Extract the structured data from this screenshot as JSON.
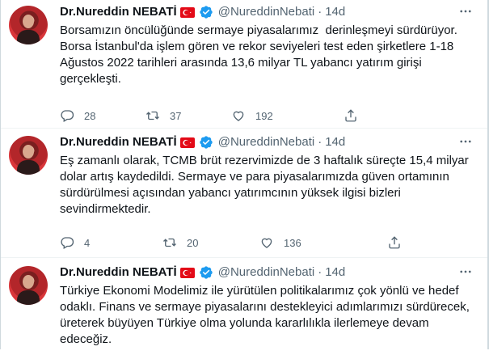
{
  "tweets": [
    {
      "name": "Dr.Nureddin NEBATİ",
      "handle": "@NureddinNebati",
      "separator": "·",
      "time": "14d",
      "text": "Borsamızın öncülüğünde sermaye piyasalarımız  derinleşmeyi sürdürüyor.\nBorsa İstanbul'da işlem gören ve rekor seviyeleri test eden şirketlere 1-18\nAğustos 2022 tarihleri arasında 13,6 milyar TL yabancı yatırım girişi\ngerçekleşti.",
      "replies": "28",
      "retweets": "37",
      "likes": "192"
    },
    {
      "name": "Dr.Nureddin NEBATİ",
      "handle": "@NureddinNebati",
      "separator": "·",
      "time": "14d",
      "text": "Eş zamanlı olarak, TCMB brüt rezervimizde de 3 haftalık süreçte 15,4 milyar\ndolar artış kaydedildi. Sermaye ve para piyasalarımızda güven ortamının\nsürdürülmesi açısından yabancı yatırımcının yüksek ilgisi bizleri\nsevindirmektedir.",
      "replies": "4",
      "retweets": "20",
      "likes": "136"
    },
    {
      "name": "Dr.Nureddin NEBATİ",
      "handle": "@NureddinNebati",
      "separator": "·",
      "time": "14d",
      "text": "Türkiye Ekonomi Modelimiz ile yürütülen politikalarımız çok yönlü ve hedef\nodaklı. Finans ve sermaye piyasalarını destekleyici adımlarımızı sürdürecek,\nüreterek büyüyen Türkiye olma yolunda kararlılıkla ilerlemeye devam\nedeceğiz."
    }
  ],
  "colors": {
    "text": "#0f1419",
    "secondary": "#536471",
    "verified": "#1d9bf0",
    "flag": "#e30a17"
  },
  "icons": [
    "avatar",
    "turkey-flag-icon",
    "verified-badge-icon",
    "more-options-icon",
    "reply-icon",
    "retweet-icon",
    "like-icon",
    "share-icon"
  ]
}
